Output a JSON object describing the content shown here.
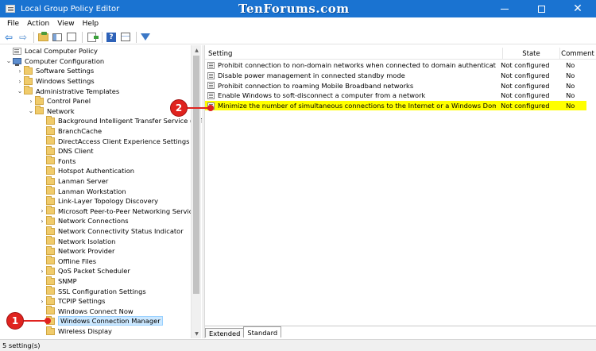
{
  "window": {
    "title": "Local Group Policy Editor",
    "watermark": "TenForums.com",
    "minimize": "",
    "maximize": "",
    "close": "✕"
  },
  "menu": [
    "File",
    "Action",
    "View",
    "Help"
  ],
  "toolbar": {
    "back": "⇦",
    "forward": "⇨",
    "help": "?"
  },
  "tree": [
    {
      "label": "Local Computer Policy",
      "depth": 0,
      "toggle": "",
      "icon": "policy"
    },
    {
      "label": "Computer Configuration",
      "depth": 1,
      "toggle": "⌄",
      "icon": "computer"
    },
    {
      "label": "Software Settings",
      "depth": 2,
      "toggle": "›",
      "icon": "folder"
    },
    {
      "label": "Windows Settings",
      "depth": 2,
      "toggle": "›",
      "icon": "folder"
    },
    {
      "label": "Administrative Templates",
      "depth": 2,
      "toggle": "⌄",
      "icon": "folder"
    },
    {
      "label": "Control Panel",
      "depth": 3,
      "toggle": "›",
      "icon": "folder"
    },
    {
      "label": "Network",
      "depth": 3,
      "toggle": "⌄",
      "icon": "folder"
    },
    {
      "label": "Background Intelligent Transfer Service (BITS)",
      "depth": 4,
      "toggle": "",
      "icon": "folder"
    },
    {
      "label": "BranchCache",
      "depth": 4,
      "toggle": "",
      "icon": "folder"
    },
    {
      "label": "DirectAccess Client Experience Settings",
      "depth": 4,
      "toggle": "",
      "icon": "folder"
    },
    {
      "label": "DNS Client",
      "depth": 4,
      "toggle": "",
      "icon": "folder"
    },
    {
      "label": "Fonts",
      "depth": 4,
      "toggle": "",
      "icon": "folder"
    },
    {
      "label": "Hotspot Authentication",
      "depth": 4,
      "toggle": "",
      "icon": "folder"
    },
    {
      "label": "Lanman Server",
      "depth": 4,
      "toggle": "",
      "icon": "folder"
    },
    {
      "label": "Lanman Workstation",
      "depth": 4,
      "toggle": "",
      "icon": "folder"
    },
    {
      "label": "Link-Layer Topology Discovery",
      "depth": 4,
      "toggle": "",
      "icon": "folder"
    },
    {
      "label": "Microsoft Peer-to-Peer Networking Services",
      "depth": 4,
      "toggle": "›",
      "icon": "folder"
    },
    {
      "label": "Network Connections",
      "depth": 4,
      "toggle": "›",
      "icon": "folder"
    },
    {
      "label": "Network Connectivity Status Indicator",
      "depth": 4,
      "toggle": "",
      "icon": "folder"
    },
    {
      "label": "Network Isolation",
      "depth": 4,
      "toggle": "",
      "icon": "folder"
    },
    {
      "label": "Network Provider",
      "depth": 4,
      "toggle": "",
      "icon": "folder"
    },
    {
      "label": "Offline Files",
      "depth": 4,
      "toggle": "",
      "icon": "folder"
    },
    {
      "label": "QoS Packet Scheduler",
      "depth": 4,
      "toggle": "›",
      "icon": "folder"
    },
    {
      "label": "SNMP",
      "depth": 4,
      "toggle": "",
      "icon": "folder"
    },
    {
      "label": "SSL Configuration Settings",
      "depth": 4,
      "toggle": "",
      "icon": "folder"
    },
    {
      "label": "TCPIP Settings",
      "depth": 4,
      "toggle": "›",
      "icon": "folder"
    },
    {
      "label": "Windows Connect Now",
      "depth": 4,
      "toggle": "",
      "icon": "folder"
    },
    {
      "label": "Windows Connection Manager",
      "depth": 4,
      "toggle": "",
      "icon": "folder",
      "selected": true
    },
    {
      "label": "Wireless Display",
      "depth": 4,
      "toggle": "",
      "icon": "folder"
    }
  ],
  "list": {
    "headers": {
      "setting": "Setting",
      "state": "State",
      "comment": "Comment"
    },
    "rows": [
      {
        "setting": "Prohibit connection to non-domain networks when connected to domain authenticated network",
        "state": "Not configured",
        "comment": "No"
      },
      {
        "setting": "Disable power management in connected standby mode",
        "state": "Not configured",
        "comment": "No"
      },
      {
        "setting": "Prohibit connection to roaming Mobile Broadband networks",
        "state": "Not configured",
        "comment": "No"
      },
      {
        "setting": "Enable Windows to soft-disconnect a computer from a network",
        "state": "Not configured",
        "comment": "No"
      },
      {
        "setting": "Minimize the number of simultaneous connections to the Internet or a Windows Domain",
        "state": "Not configured",
        "comment": "No",
        "highlighted": true
      }
    ]
  },
  "tabs": [
    "Extended",
    "Standard"
  ],
  "active_tab": "Standard",
  "status": "5 setting(s)",
  "callouts": [
    "1",
    "2"
  ],
  "colors": {
    "titlebar": "#1a73d1",
    "highlight": "#ffff00",
    "callout": "#e0231f",
    "selection": "#cce8ff"
  }
}
